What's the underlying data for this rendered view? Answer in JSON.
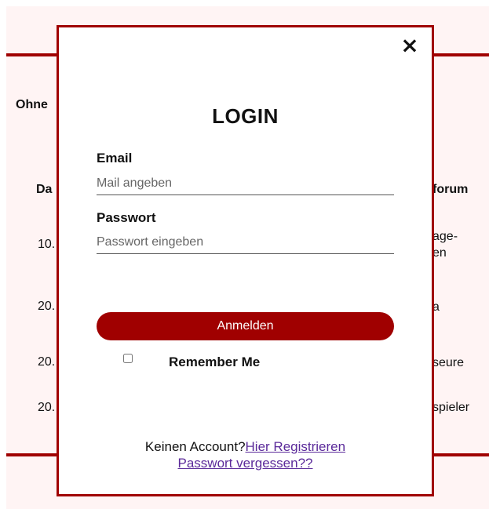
{
  "background": {
    "intro_text": "Ohne",
    "column_left_header": "Da",
    "column_right_header": "forum",
    "left_cells": [
      "10.",
      "20.",
      "20.",
      "20."
    ],
    "right_cells": [
      "age-",
      "en",
      "a",
      "seure",
      "spieler"
    ]
  },
  "modal": {
    "close_icon": "×",
    "title": "LOGIN",
    "email": {
      "label": "Email",
      "placeholder": "Mail angeben"
    },
    "password": {
      "label": "Passwort",
      "placeholder": "Passwort eingeben"
    },
    "submit_label": "Anmelden",
    "remember_label": "Remember Me",
    "footer": {
      "no_account_text": "Keinen Account?",
      "register_link": "Hier Registrieren",
      "forgot_link": "Passwort vergessen??"
    }
  },
  "colors": {
    "accent": "#a00000",
    "page_bg": "#fff4f4",
    "link": "#5b2a9a"
  }
}
